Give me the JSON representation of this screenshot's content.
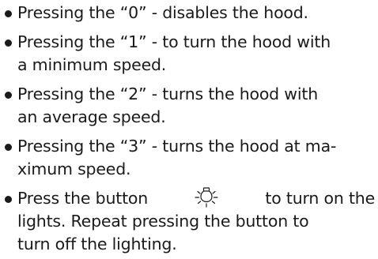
{
  "instructions": {
    "items": [
      {
        "lines": [
          "Pressing the “0” - disables the hood."
        ]
      },
      {
        "lines": [
          "Pressing the “1” - to turn the hood with",
          "a minimum speed."
        ]
      },
      {
        "lines": [
          "Pressing the “2” - turns the hood with",
          "an average speed."
        ]
      },
      {
        "lines": [
          "Pressing the “3” - turns the hood at ma-",
          "ximum speed."
        ]
      },
      {
        "line1_before_icon": "Press the button",
        "line1_after_icon": "to turn on the",
        "icon": "light-bulb-icon",
        "lines_rest": [
          "lights. Repeat pressing the button to",
          "turn off the lighting."
        ]
      }
    ]
  }
}
